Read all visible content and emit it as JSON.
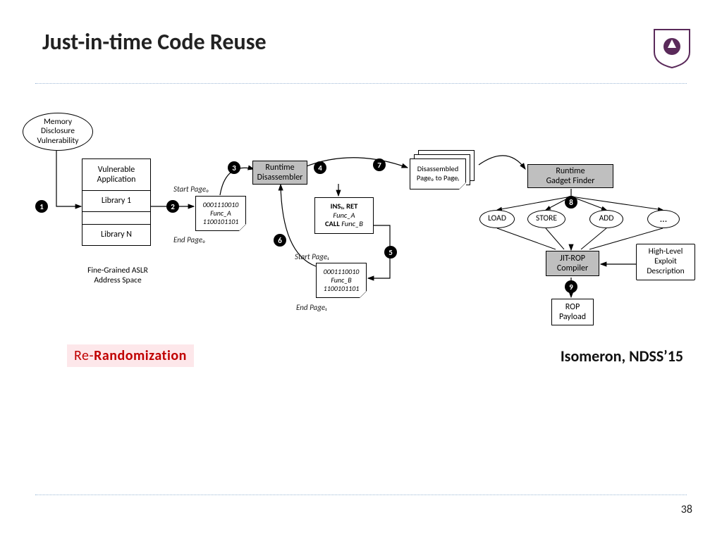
{
  "title": "Just-in-time Code Reuse",
  "page_number": "38",
  "highlight_prefix": "Re-",
  "highlight_strong": "Randomization",
  "citation": "Isomeron, NDSS’15",
  "nodes": {
    "memvuln": "Memory\nDisclosure\nVulnerability",
    "vapp": "Vulnerable\nApplication",
    "lib1": "Library 1",
    "libn": "Library N",
    "fg_aslr": "Fine-Grained ASLR\nAddress Space",
    "startpage0": "Start Page₀",
    "endpage0": "End Page₀",
    "page0": "0001110010\nFunc_A\n1100101101",
    "runtime_dis": "Runtime\nDisassembler",
    "insret": "INS₁, RET",
    "funca": "Func_A",
    "callfb": "CALL Func_B",
    "startpage1": "Start Page₁",
    "endpage1": "End Page₁",
    "page1": "0001110010\nFunc_B\n1100101101",
    "dis_pages": "Disassembled\nPage₀ to Pageᵢ",
    "gadget_finder": "Runtime\nGadget Finder",
    "load": "LOAD",
    "store": "STORE",
    "add": "ADD",
    "more": "…",
    "jit_rop": "JIT-ROP\nCompiler",
    "exploit_desc": "High-Level\nExploit\nDescription",
    "rop_payload": "ROP\nPayload"
  },
  "bubbles": [
    "1",
    "2",
    "3",
    "4",
    "5",
    "6",
    "7",
    "8",
    "9"
  ]
}
